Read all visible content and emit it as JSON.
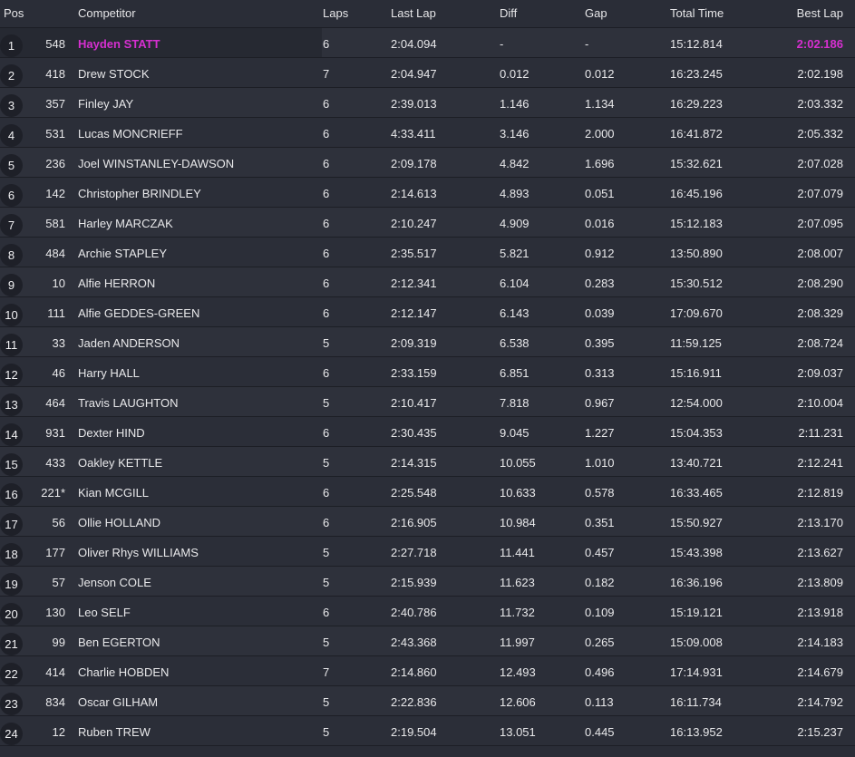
{
  "headers": {
    "pos": "Pos",
    "competitor": "Competitor",
    "laps": "Laps",
    "last_lap": "Last Lap",
    "diff": "Diff",
    "gap": "Gap",
    "total_time": "Total Time",
    "best_lap": "Best Lap"
  },
  "colors": {
    "fastest_highlight": "#d62fd0",
    "background": "#2a2d37"
  },
  "rows": [
    {
      "pos": "1",
      "num": "548",
      "name": "Hayden STATT",
      "laps": "6",
      "last": "2:04.094",
      "diff": "-",
      "gap": "-",
      "total": "15:12.814",
      "best": "2:02.186"
    },
    {
      "pos": "2",
      "num": "418",
      "name": "Drew STOCK",
      "laps": "7",
      "last": "2:04.947",
      "diff": "0.012",
      "gap": "0.012",
      "total": "16:23.245",
      "best": "2:02.198"
    },
    {
      "pos": "3",
      "num": "357",
      "name": "Finley JAY",
      "laps": "6",
      "last": "2:39.013",
      "diff": "1.146",
      "gap": "1.134",
      "total": "16:29.223",
      "best": "2:03.332"
    },
    {
      "pos": "4",
      "num": "531",
      "name": "Lucas MONCRIEFF",
      "laps": "6",
      "last": "4:33.411",
      "diff": "3.146",
      "gap": "2.000",
      "total": "16:41.872",
      "best": "2:05.332"
    },
    {
      "pos": "5",
      "num": "236",
      "name": "Joel WINSTANLEY-DAWSON",
      "laps": "6",
      "last": "2:09.178",
      "diff": "4.842",
      "gap": "1.696",
      "total": "15:32.621",
      "best": "2:07.028"
    },
    {
      "pos": "6",
      "num": "142",
      "name": "Christopher BRINDLEY",
      "laps": "6",
      "last": "2:14.613",
      "diff": "4.893",
      "gap": "0.051",
      "total": "16:45.196",
      "best": "2:07.079"
    },
    {
      "pos": "7",
      "num": "581",
      "name": "Harley MARCZAK",
      "laps": "6",
      "last": "2:10.247",
      "diff": "4.909",
      "gap": "0.016",
      "total": "15:12.183",
      "best": "2:07.095"
    },
    {
      "pos": "8",
      "num": "484",
      "name": "Archie STAPLEY",
      "laps": "6",
      "last": "2:35.517",
      "diff": "5.821",
      "gap": "0.912",
      "total": "13:50.890",
      "best": "2:08.007"
    },
    {
      "pos": "9",
      "num": "10",
      "name": "Alfie HERRON",
      "laps": "6",
      "last": "2:12.341",
      "diff": "6.104",
      "gap": "0.283",
      "total": "15:30.512",
      "best": "2:08.290"
    },
    {
      "pos": "10",
      "num": "111",
      "name": "Alfie GEDDES-GREEN",
      "laps": "6",
      "last": "2:12.147",
      "diff": "6.143",
      "gap": "0.039",
      "total": "17:09.670",
      "best": "2:08.329"
    },
    {
      "pos": "11",
      "num": "33",
      "name": "Jaden ANDERSON",
      "laps": "5",
      "last": "2:09.319",
      "diff": "6.538",
      "gap": "0.395",
      "total": "11:59.125",
      "best": "2:08.724"
    },
    {
      "pos": "12",
      "num": "46",
      "name": "Harry HALL",
      "laps": "6",
      "last": "2:33.159",
      "diff": "6.851",
      "gap": "0.313",
      "total": "15:16.911",
      "best": "2:09.037"
    },
    {
      "pos": "13",
      "num": "464",
      "name": "Travis LAUGHTON",
      "laps": "5",
      "last": "2:10.417",
      "diff": "7.818",
      "gap": "0.967",
      "total": "12:54.000",
      "best": "2:10.004"
    },
    {
      "pos": "14",
      "num": "931",
      "name": "Dexter HIND",
      "laps": "6",
      "last": "2:30.435",
      "diff": "9.045",
      "gap": "1.227",
      "total": "15:04.353",
      "best": "2:11.231"
    },
    {
      "pos": "15",
      "num": "433",
      "name": "Oakley KETTLE",
      "laps": "5",
      "last": "2:14.315",
      "diff": "10.055",
      "gap": "1.010",
      "total": "13:40.721",
      "best": "2:12.241"
    },
    {
      "pos": "16",
      "num": "221*",
      "name": "Kian MCGILL",
      "laps": "6",
      "last": "2:25.548",
      "diff": "10.633",
      "gap": "0.578",
      "total": "16:33.465",
      "best": "2:12.819"
    },
    {
      "pos": "17",
      "num": "56",
      "name": "Ollie HOLLAND",
      "laps": "6",
      "last": "2:16.905",
      "diff": "10.984",
      "gap": "0.351",
      "total": "15:50.927",
      "best": "2:13.170"
    },
    {
      "pos": "18",
      "num": "177",
      "name": "Oliver Rhys WILLIAMS",
      "laps": "5",
      "last": "2:27.718",
      "diff": "11.441",
      "gap": "0.457",
      "total": "15:43.398",
      "best": "2:13.627"
    },
    {
      "pos": "19",
      "num": "57",
      "name": "Jenson COLE",
      "laps": "5",
      "last": "2:15.939",
      "diff": "11.623",
      "gap": "0.182",
      "total": "16:36.196",
      "best": "2:13.809"
    },
    {
      "pos": "20",
      "num": "130",
      "name": "Leo SELF",
      "laps": "6",
      "last": "2:40.786",
      "diff": "11.732",
      "gap": "0.109",
      "total": "15:19.121",
      "best": "2:13.918"
    },
    {
      "pos": "21",
      "num": "99",
      "name": "Ben EGERTON",
      "laps": "5",
      "last": "2:43.368",
      "diff": "11.997",
      "gap": "0.265",
      "total": "15:09.008",
      "best": "2:14.183"
    },
    {
      "pos": "22",
      "num": "414",
      "name": "Charlie HOBDEN",
      "laps": "7",
      "last": "2:14.860",
      "diff": "12.493",
      "gap": "0.496",
      "total": "17:14.931",
      "best": "2:14.679"
    },
    {
      "pos": "23",
      "num": "834",
      "name": "Oscar GILHAM",
      "laps": "5",
      "last": "2:22.836",
      "diff": "12.606",
      "gap": "0.113",
      "total": "16:11.734",
      "best": "2:14.792"
    },
    {
      "pos": "24",
      "num": "12",
      "name": "Ruben TREW",
      "laps": "5",
      "last": "2:19.504",
      "diff": "13.051",
      "gap": "0.445",
      "total": "16:13.952",
      "best": "2:15.237"
    }
  ]
}
